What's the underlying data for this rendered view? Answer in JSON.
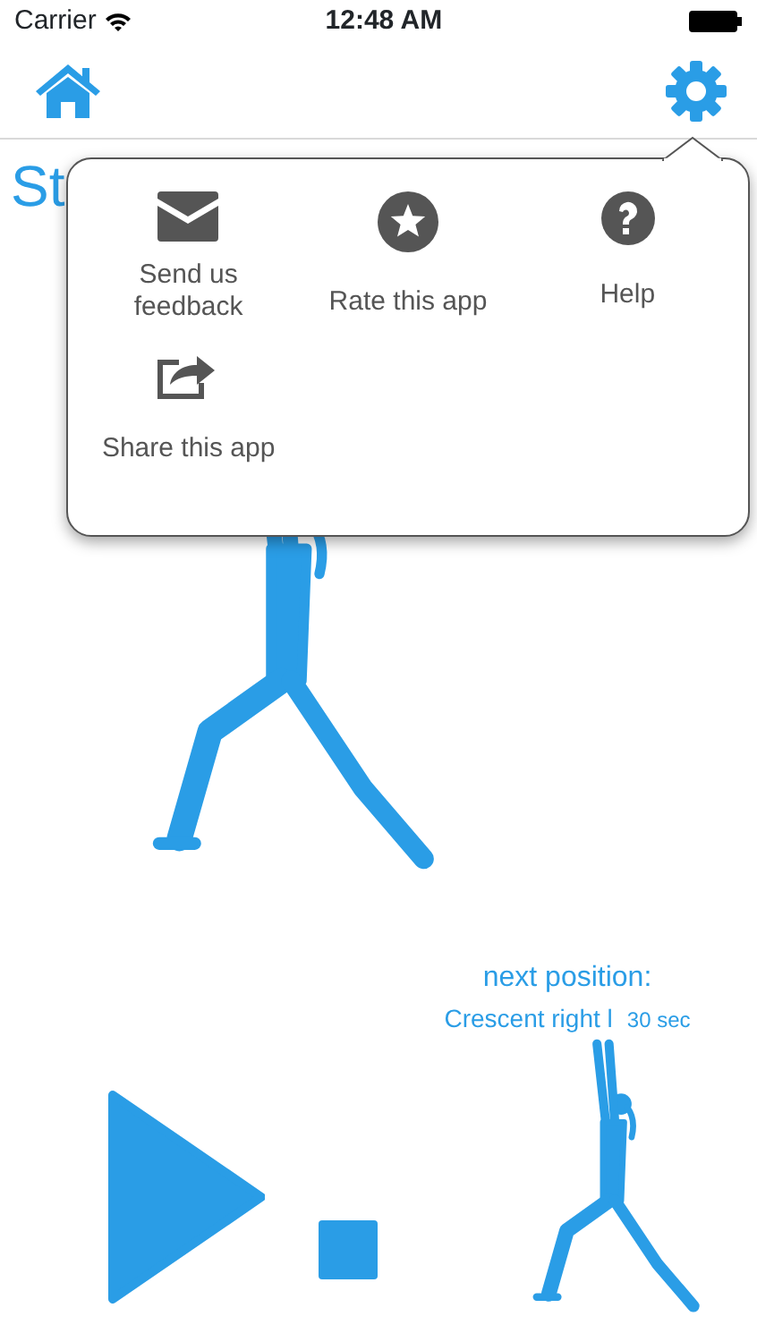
{
  "status_bar": {
    "carrier": "Carrier",
    "time": "12:48 AM"
  },
  "title": "St",
  "popover": {
    "items": [
      {
        "kind": "envelope",
        "label": "Send us feedback"
      },
      {
        "kind": "star",
        "label": "Rate this app"
      },
      {
        "kind": "help",
        "label": "Help"
      },
      {
        "kind": "share",
        "label": "Share this app"
      }
    ]
  },
  "next": {
    "heading": "next position:",
    "pose": "Crescent right l",
    "duration": "30 sec"
  }
}
